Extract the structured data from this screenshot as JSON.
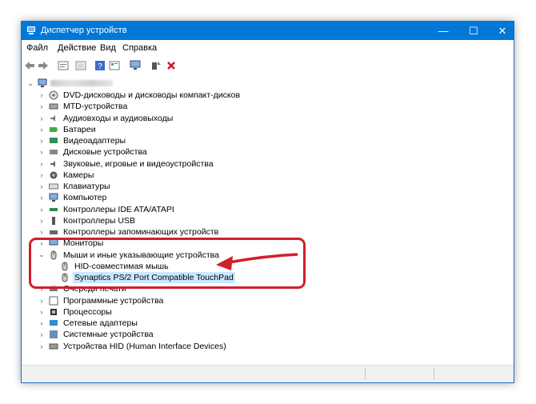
{
  "window": {
    "title": "Диспетчер устройств",
    "controls": {
      "minimize": "—",
      "maximize": "☐",
      "close": "✕"
    },
    "accent": "#0078d7"
  },
  "menu": [
    "Файл",
    "Действие",
    "Вид",
    "Справка"
  ],
  "toolbar": {
    "icons": [
      "back-arrow-icon",
      "forward-arrow-icon",
      "properties-icon",
      "show-hidden-icon",
      "help-icon",
      "view-icon",
      "monitor-icon",
      "update-driver-icon",
      "uninstall-x-icon"
    ]
  },
  "tree": {
    "categories": [
      {
        "label": "DVD-дисководы и дисководы компакт-дисков",
        "icon": "dvd-icon"
      },
      {
        "label": "MTD-устройства",
        "icon": "mtd-icon"
      },
      {
        "label": "Аудиовходы и аудиовыходы",
        "icon": "audio-icon"
      },
      {
        "label": "Батареи",
        "icon": "battery-icon"
      },
      {
        "label": "Видеоадаптеры",
        "icon": "display-adapter-icon"
      },
      {
        "label": "Дисковые устройства",
        "icon": "disk-icon"
      },
      {
        "label": "Звуковые, игровые и видеоустройства",
        "icon": "sound-icon"
      },
      {
        "label": "Камеры",
        "icon": "camera-icon"
      },
      {
        "label": "Клавиатуры",
        "icon": "keyboard-icon"
      },
      {
        "label": "Компьютер",
        "icon": "computer-icon"
      },
      {
        "label": "Контроллеры IDE ATA/ATAPI",
        "icon": "ide-icon"
      },
      {
        "label": "Контроллеры USB",
        "icon": "usb-icon"
      },
      {
        "label": "Контроллеры запоминающих устройств",
        "icon": "storage-icon"
      },
      {
        "label": "Мониторы",
        "icon": "monitor-icon"
      },
      {
        "label": "Мыши и иные указывающие устройства",
        "icon": "mouse-icon"
      },
      {
        "label": "Очереди печати",
        "icon": "printer-icon"
      },
      {
        "label": "Программные устройства",
        "icon": "software-device-icon"
      },
      {
        "label": "Процессоры",
        "icon": "processor-icon"
      },
      {
        "label": "Сетевые адаптеры",
        "icon": "network-icon"
      },
      {
        "label": "Системные устройства",
        "icon": "system-icon"
      },
      {
        "label": "Устройства HID (Human Interface Devices)",
        "icon": "hid-icon"
      }
    ],
    "mouse_children": [
      {
        "label": "HID-совместимая мышь",
        "icon": "mouse-icon"
      },
      {
        "label": "Synaptics PS/2 Port Compatible TouchPad",
        "icon": "mouse-icon"
      }
    ]
  },
  "annotation": {
    "color": "#d11f2b"
  }
}
